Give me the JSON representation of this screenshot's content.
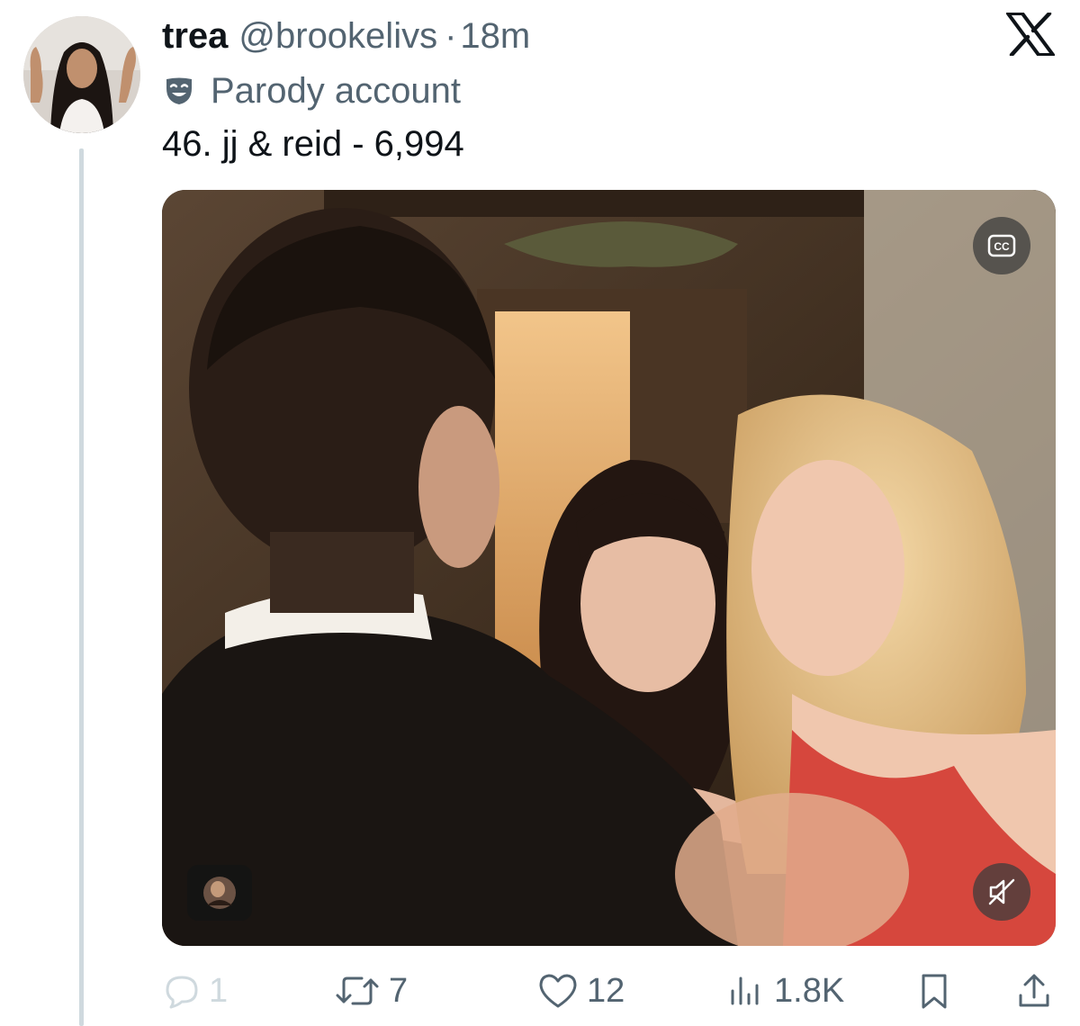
{
  "tweet": {
    "display_name": "trea",
    "handle": "@brookelivs",
    "separator": "·",
    "timestamp": "18m",
    "badge_label": "Parody account",
    "badge_icon": "parody-mask-icon",
    "text": "46. jj & reid - 6,994"
  },
  "media": {
    "cc_icon_label": "CC",
    "mute_icon": "speaker-muted-icon"
  },
  "actions": {
    "replies": "1",
    "reposts": "7",
    "likes": "12",
    "views": "1.8K"
  },
  "icons": [
    "x-logo-icon",
    "reply-icon",
    "repost-icon",
    "like-icon",
    "views-icon",
    "bookmark-icon",
    "share-icon"
  ],
  "colors": {
    "text_primary": "#0f1419",
    "text_secondary": "#536471",
    "thread_line": "#cfd9de"
  }
}
